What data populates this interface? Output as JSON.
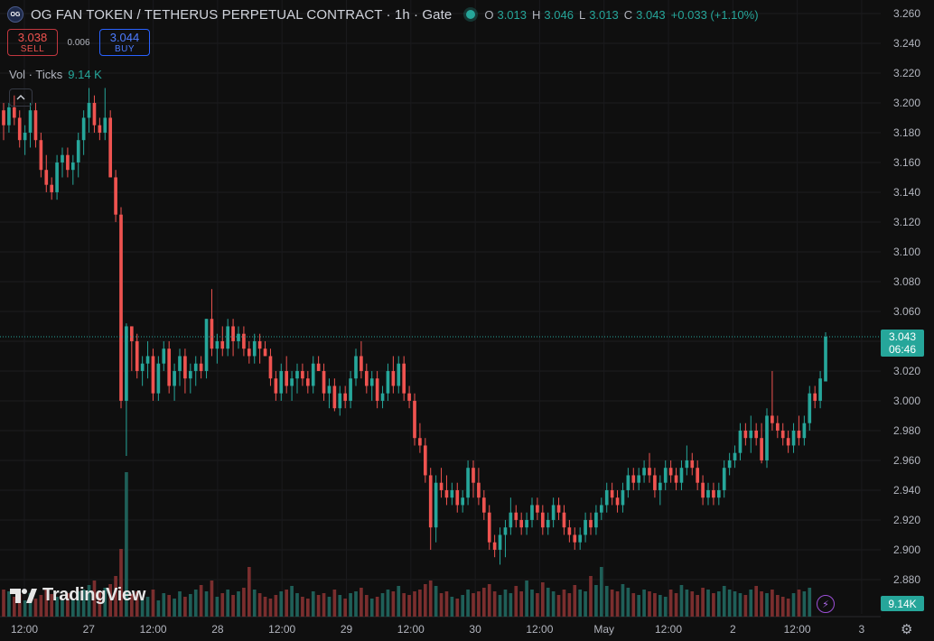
{
  "header": {
    "title": "OG FAN TOKEN / TETHERUS PERPETUAL CONTRACT · 1h · Gate",
    "logo_text": "OG",
    "ohlc": [
      {
        "key": "O",
        "value": "3.013"
      },
      {
        "key": "H",
        "value": "3.046"
      },
      {
        "key": "L",
        "value": "3.013"
      },
      {
        "key": "C",
        "value": "3.043"
      }
    ],
    "change": "+0.033 (+1.10%)"
  },
  "trade": {
    "sell_price": "3.038",
    "sell_label": "SELL",
    "spread": "0.006",
    "buy_price": "3.044",
    "buy_label": "BUY"
  },
  "volume_legend": {
    "label": "Vol · Ticks",
    "value": "9.14 K"
  },
  "collapse_icon": "chevron-up-icon",
  "branding": {
    "name": "TradingView"
  },
  "price_badge": {
    "price": "3.043",
    "countdown": "06:46"
  },
  "volume_badge": "9.14K",
  "colors": {
    "background": "#0f0f0f",
    "up": "#26a69a",
    "down": "#ef5350",
    "up_volume": "#1f5f58",
    "down_volume": "#7a2e2e",
    "axis_text": "#b2b5be"
  },
  "chart_data": {
    "type": "candlestick",
    "title": "OG FAN TOKEN / TETHERUS PERPETUAL CONTRACT · 1h · Gate",
    "xlabel": "",
    "ylabel": "",
    "ylim": [
      2.863,
      3.263
    ],
    "grid": true,
    "y_ticks": [
      "3.260",
      "3.240",
      "3.220",
      "3.200",
      "3.180",
      "3.160",
      "3.140",
      "3.120",
      "3.100",
      "3.080",
      "3.060",
      "3.040",
      "3.020",
      "3.000",
      "2.980",
      "2.960",
      "2.940",
      "2.920",
      "2.900",
      "2.880"
    ],
    "x_ticks": [
      "12:00",
      "27",
      "12:00",
      "28",
      "12:00",
      "29",
      "12:00",
      "30",
      "12:00",
      "May",
      "12:00",
      "2",
      "12:00",
      "3"
    ],
    "last_price": 3.043,
    "candles": [
      [
        3.195,
        3.2,
        3.175,
        3.185
      ],
      [
        3.185,
        3.2,
        3.18,
        3.197
      ],
      [
        3.197,
        3.205,
        3.185,
        3.19
      ],
      [
        3.19,
        3.195,
        3.17,
        3.175
      ],
      [
        3.175,
        3.185,
        3.165,
        3.18
      ],
      [
        3.18,
        3.2,
        3.17,
        3.195
      ],
      [
        3.195,
        3.2,
        3.17,
        3.175
      ],
      [
        3.175,
        3.18,
        3.15,
        3.155
      ],
      [
        3.155,
        3.165,
        3.14,
        3.145
      ],
      [
        3.145,
        3.15,
        3.135,
        3.14
      ],
      [
        3.14,
        3.165,
        3.135,
        3.16
      ],
      [
        3.16,
        3.17,
        3.15,
        3.165
      ],
      [
        3.165,
        3.17,
        3.15,
        3.155
      ],
      [
        3.155,
        3.165,
        3.145,
        3.16
      ],
      [
        3.16,
        3.18,
        3.15,
        3.175
      ],
      [
        3.175,
        3.195,
        3.165,
        3.19
      ],
      [
        3.19,
        3.21,
        3.18,
        3.2
      ],
      [
        3.2,
        3.205,
        3.18,
        3.185
      ],
      [
        3.185,
        3.19,
        3.175,
        3.18
      ],
      [
        3.18,
        3.21,
        3.175,
        3.19
      ],
      [
        3.19,
        3.195,
        3.15,
        3.15
      ],
      [
        3.15,
        3.155,
        3.12,
        3.125
      ],
      [
        3.125,
        3.13,
        2.995,
        3.0
      ],
      [
        3.0,
        3.052,
        2.963,
        3.05
      ],
      [
        3.05,
        3.05,
        3.02,
        3.04
      ],
      [
        3.04,
        3.045,
        3.015,
        3.02
      ],
      [
        3.02,
        3.03,
        3.01,
        3.025
      ],
      [
        3.025,
        3.04,
        3.015,
        3.03
      ],
      [
        3.03,
        3.035,
        3.0,
        3.005
      ],
      [
        3.005,
        3.03,
        3.0,
        3.025
      ],
      [
        3.025,
        3.04,
        3.02,
        3.035
      ],
      [
        3.035,
        3.04,
        3.005,
        3.01
      ],
      [
        3.01,
        3.025,
        3.0,
        3.02
      ],
      [
        3.02,
        3.035,
        3.01,
        3.03
      ],
      [
        3.03,
        3.035,
        3.005,
        3.015
      ],
      [
        3.015,
        3.025,
        3.005,
        3.02
      ],
      [
        3.02,
        3.03,
        3.01,
        3.025
      ],
      [
        3.025,
        3.03,
        3.015,
        3.02
      ],
      [
        3.02,
        3.055,
        3.015,
        3.055
      ],
      [
        3.055,
        3.075,
        3.03,
        3.035
      ],
      [
        3.035,
        3.045,
        3.025,
        3.04
      ],
      [
        3.04,
        3.05,
        3.03,
        3.035
      ],
      [
        3.035,
        3.055,
        3.03,
        3.05
      ],
      [
        3.05,
        3.055,
        3.03,
        3.04
      ],
      [
        3.04,
        3.05,
        3.035,
        3.045
      ],
      [
        3.045,
        3.05,
        3.03,
        3.035
      ],
      [
        3.035,
        3.04,
        3.025,
        3.03
      ],
      [
        3.03,
        3.045,
        3.025,
        3.04
      ],
      [
        3.04,
        3.045,
        3.025,
        3.035
      ],
      [
        3.035,
        3.04,
        3.03,
        3.03
      ],
      [
        3.03,
        3.035,
        3.01,
        3.015
      ],
      [
        3.015,
        3.02,
        3.0,
        3.005
      ],
      [
        3.005,
        3.025,
        3.0,
        3.02
      ],
      [
        3.02,
        3.03,
        3.005,
        3.01
      ],
      [
        3.01,
        3.02,
        3.0,
        3.015
      ],
      [
        3.015,
        3.025,
        3.005,
        3.02
      ],
      [
        3.02,
        3.025,
        3.01,
        3.015
      ],
      [
        3.015,
        3.02,
        3.005,
        3.01
      ],
      [
        3.01,
        3.03,
        3.005,
        3.025
      ],
      [
        3.025,
        3.03,
        3.02,
        3.02
      ],
      [
        3.02,
        3.025,
        3.0,
        3.005
      ],
      [
        3.005,
        3.015,
        2.995,
        3.01
      ],
      [
        3.01,
        3.015,
        2.993,
        2.995
      ],
      [
        2.995,
        3.01,
        2.99,
        3.005
      ],
      [
        3.005,
        3.01,
        2.995,
        3.0
      ],
      [
        3.0,
        3.02,
        2.995,
        3.015
      ],
      [
        3.015,
        3.035,
        3.01,
        3.03
      ],
      [
        3.03,
        3.04,
        3.015,
        3.02
      ],
      [
        3.02,
        3.025,
        3.005,
        3.01
      ],
      [
        3.01,
        3.02,
        3.0,
        3.015
      ],
      [
        3.015,
        3.02,
        2.995,
        3.0
      ],
      [
        3.0,
        3.01,
        2.995,
        3.005
      ],
      [
        3.005,
        3.025,
        3.0,
        3.02
      ],
      [
        3.02,
        3.03,
        3.005,
        3.01
      ],
      [
        3.01,
        3.03,
        3.005,
        3.025
      ],
      [
        3.025,
        3.03,
        3.0,
        3.005
      ],
      [
        3.005,
        3.01,
        2.995,
        3.0
      ],
      [
        3.0,
        3.005,
        2.97,
        2.975
      ],
      [
        2.975,
        2.985,
        2.965,
        2.97
      ],
      [
        2.97,
        2.975,
        2.945,
        2.95
      ],
      [
        2.95,
        2.955,
        2.9,
        2.915
      ],
      [
        2.915,
        2.95,
        2.905,
        2.945
      ],
      [
        2.945,
        2.955,
        2.935,
        2.94
      ],
      [
        2.94,
        2.95,
        2.93,
        2.935
      ],
      [
        2.935,
        2.945,
        2.93,
        2.94
      ],
      [
        2.94,
        2.945,
        2.925,
        2.93
      ],
      [
        2.93,
        2.94,
        2.925,
        2.935
      ],
      [
        2.935,
        2.96,
        2.93,
        2.955
      ],
      [
        2.955,
        2.96,
        2.935,
        2.945
      ],
      [
        2.945,
        2.955,
        2.93,
        2.935
      ],
      [
        2.935,
        2.94,
        2.92,
        2.925
      ],
      [
        2.925,
        2.93,
        2.9,
        2.905
      ],
      [
        2.905,
        2.91,
        2.895,
        2.9
      ],
      [
        2.9,
        2.915,
        2.89,
        2.91
      ],
      [
        2.91,
        2.92,
        2.895,
        2.915
      ],
      [
        2.915,
        2.935,
        2.91,
        2.925
      ],
      [
        2.925,
        2.93,
        2.915,
        2.92
      ],
      [
        2.92,
        2.925,
        2.91,
        2.915
      ],
      [
        2.915,
        2.925,
        2.91,
        2.92
      ],
      [
        2.92,
        2.935,
        2.915,
        2.93
      ],
      [
        2.93,
        2.935,
        2.92,
        2.925
      ],
      [
        2.925,
        2.93,
        2.91,
        2.915
      ],
      [
        2.915,
        2.925,
        2.91,
        2.92
      ],
      [
        2.92,
        2.935,
        2.915,
        2.93
      ],
      [
        2.93,
        2.935,
        2.92,
        2.925
      ],
      [
        2.925,
        2.93,
        2.91,
        2.915
      ],
      [
        2.915,
        2.92,
        2.905,
        2.91
      ],
      [
        2.91,
        2.915,
        2.9,
        2.905
      ],
      [
        2.905,
        2.915,
        2.9,
        2.91
      ],
      [
        2.91,
        2.925,
        2.905,
        2.92
      ],
      [
        2.92,
        2.925,
        2.91,
        2.915
      ],
      [
        2.915,
        2.93,
        2.91,
        2.925
      ],
      [
        2.925,
        2.935,
        2.92,
        2.93
      ],
      [
        2.93,
        2.945,
        2.925,
        2.94
      ],
      [
        2.94,
        2.945,
        2.93,
        2.935
      ],
      [
        2.935,
        2.94,
        2.925,
        2.93
      ],
      [
        2.93,
        2.945,
        2.925,
        2.94
      ],
      [
        2.94,
        2.955,
        2.935,
        2.95
      ],
      [
        2.95,
        2.955,
        2.94,
        2.945
      ],
      [
        2.945,
        2.955,
        2.94,
        2.95
      ],
      [
        2.95,
        2.96,
        2.945,
        2.955
      ],
      [
        2.955,
        2.965,
        2.945,
        2.95
      ],
      [
        2.95,
        2.955,
        2.935,
        2.94
      ],
      [
        2.94,
        2.95,
        2.93,
        2.945
      ],
      [
        2.945,
        2.96,
        2.94,
        2.955
      ],
      [
        2.955,
        2.96,
        2.945,
        2.95
      ],
      [
        2.95,
        2.955,
        2.94,
        2.945
      ],
      [
        2.945,
        2.96,
        2.94,
        2.955
      ],
      [
        2.955,
        2.97,
        2.95,
        2.96
      ],
      [
        2.96,
        2.965,
        2.95,
        2.955
      ],
      [
        2.955,
        2.96,
        2.94,
        2.945
      ],
      [
        2.945,
        2.95,
        2.93,
        2.935
      ],
      [
        2.935,
        2.945,
        2.93,
        2.94
      ],
      [
        2.94,
        2.945,
        2.93,
        2.935
      ],
      [
        2.935,
        2.945,
        2.93,
        2.94
      ],
      [
        2.94,
        2.96,
        2.935,
        2.955
      ],
      [
        2.955,
        2.965,
        2.95,
        2.96
      ],
      [
        2.96,
        2.97,
        2.955,
        2.965
      ],
      [
        2.965,
        2.985,
        2.96,
        2.98
      ],
      [
        2.98,
        2.985,
        2.97,
        2.975
      ],
      [
        2.975,
        2.99,
        2.965,
        2.98
      ],
      [
        2.98,
        2.985,
        2.97,
        2.975
      ],
      [
        2.975,
        2.985,
        2.958,
        2.96
      ],
      [
        2.96,
        2.995,
        2.955,
        2.99
      ],
      [
        2.99,
        3.02,
        2.98,
        2.985
      ],
      [
        2.985,
        2.99,
        2.975,
        2.98
      ],
      [
        2.98,
        2.985,
        2.97,
        2.975
      ],
      [
        2.975,
        2.98,
        2.965,
        2.97
      ],
      [
        2.97,
        2.985,
        2.965,
        2.98
      ],
      [
        2.98,
        2.99,
        2.97,
        2.975
      ],
      [
        2.975,
        2.99,
        2.97,
        2.985
      ],
      [
        2.985,
        3.01,
        2.98,
        3.005
      ],
      [
        3.005,
        3.01,
        2.995,
        3.0
      ],
      [
        3.0,
        3.02,
        2.995,
        3.015
      ],
      [
        3.013,
        3.046,
        3.013,
        3.043
      ]
    ],
    "volumes": [
      30,
      28,
      22,
      25,
      18,
      26,
      20,
      24,
      30,
      25,
      22,
      18,
      26,
      20,
      28,
      30,
      35,
      40,
      28,
      32,
      36,
      45,
      75,
      160,
      25,
      28,
      20,
      22,
      30,
      18,
      26,
      24,
      20,
      28,
      22,
      25,
      30,
      35,
      28,
      40,
      22,
      26,
      30,
      24,
      28,
      32,
      55,
      30,
      26,
      22,
      20,
      24,
      28,
      30,
      34,
      26,
      22,
      20,
      28,
      24,
      26,
      22,
      30,
      24,
      20,
      26,
      28,
      32,
      24,
      20,
      22,
      26,
      30,
      28,
      34,
      26,
      24,
      28,
      30,
      36,
      40,
      34,
      26,
      28,
      22,
      20,
      24,
      30,
      26,
      28,
      32,
      36,
      28,
      24,
      30,
      26,
      34,
      28,
      40,
      30,
      26,
      38,
      32,
      28,
      24,
      30,
      26,
      35,
      30,
      28,
      45,
      35,
      55,
      34,
      30,
      28,
      36,
      32,
      26,
      24,
      30,
      28,
      26,
      24,
      22,
      30,
      26,
      35,
      30,
      28,
      24,
      32,
      30,
      26,
      28,
      34,
      30,
      28,
      26,
      24,
      30,
      34,
      28,
      26,
      30,
      24,
      22,
      20,
      26,
      30,
      28,
      32
    ]
  }
}
